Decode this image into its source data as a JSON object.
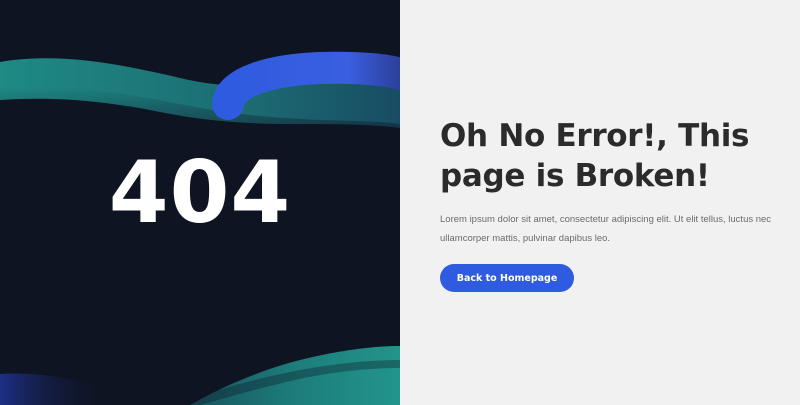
{
  "error_panel": {
    "code": "404"
  },
  "content": {
    "headline": "Oh No Error!, This page is Broken!",
    "description": "Lorem ipsum dolor sit amet, consectetur adipiscing elit. Ut elit tellus, luctus nec ullamcorper mattis, pulvinar dapibus leo.",
    "button_label": "Back to Homepage"
  },
  "colors": {
    "dark_background": "#0f1423",
    "light_background": "#f1f1f1",
    "accent_blue": "#2f5be0",
    "accent_teal": "#1f8f87",
    "headline_text": "#2b2b2b",
    "body_text": "#6b6b6b"
  }
}
